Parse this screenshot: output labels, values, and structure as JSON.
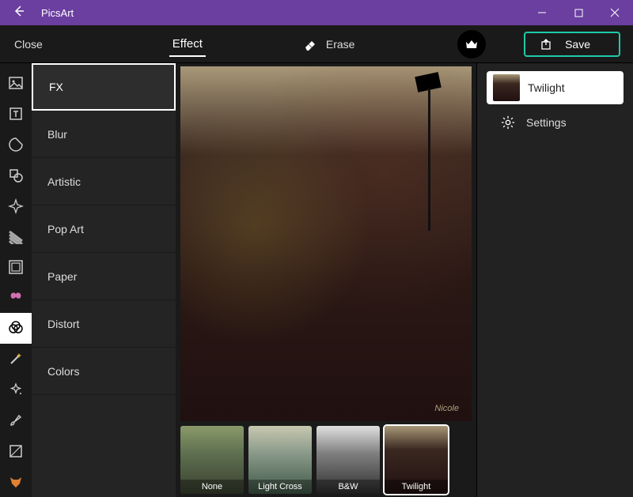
{
  "titlebar": {
    "app_name": "PicsArt"
  },
  "topbar": {
    "close_label": "Close",
    "effect_tab": "Effect",
    "erase_label": "Erase",
    "save_label": "Save"
  },
  "rail_icons": [
    "image-icon",
    "text-icon",
    "sticker-icon",
    "shape-icon",
    "sparkle-icon",
    "pattern-icon",
    "frame-icon",
    "butterfly-icon",
    "adjust-icon",
    "magic-wand-icon",
    "enhance-icon",
    "brush-icon",
    "crop-icon",
    "fox-icon"
  ],
  "categories": {
    "items": [
      {
        "label": "FX"
      },
      {
        "label": "Blur"
      },
      {
        "label": "Artistic"
      },
      {
        "label": "Pop Art"
      },
      {
        "label": "Paper"
      },
      {
        "label": "Distort"
      },
      {
        "label": "Colors"
      }
    ],
    "selected_index": 0
  },
  "preview": {
    "signature": "Nicole"
  },
  "thumbs": {
    "items": [
      {
        "label": "None"
      },
      {
        "label": "Light Cross"
      },
      {
        "label": "B&W"
      },
      {
        "label": "Twilight"
      }
    ],
    "selected_index": 3
  },
  "right_panel": {
    "current_filter": "Twilight",
    "settings_label": "Settings"
  }
}
